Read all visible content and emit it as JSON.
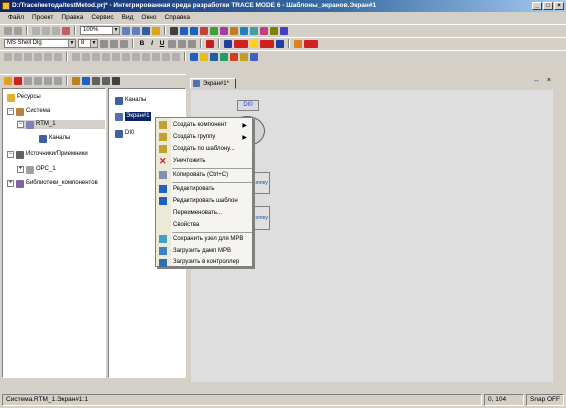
{
  "window": {
    "title": "D:/Trace/метода/testMetod.prj* - Интегрированная среда разработки TRACE MODE 6 - Шаблоны_экранов.Экран#1"
  },
  "menu": [
    "Файл",
    "Проект",
    "Правка",
    "Сервис",
    "Вид",
    "Окно",
    "Справка"
  ],
  "toolbar": {
    "zoom": "100%",
    "font": "MS Shell Dlg",
    "font_size": "8",
    "bold": "B",
    "italic": "I",
    "underline": "U"
  },
  "tree": {
    "items": [
      {
        "label": "Ресурсы"
      },
      {
        "label": "Система"
      },
      {
        "label": "RTM_1"
      },
      {
        "label": "Каналы"
      },
      {
        "label": "Источники/Приемники"
      },
      {
        "label": "OPC_1"
      },
      {
        "label": "Библиотеки_компонентов"
      }
    ]
  },
  "list": {
    "items": [
      {
        "label": "Каналы"
      },
      {
        "label": "Экран#1"
      },
      {
        "label": "DI0"
      }
    ]
  },
  "editor": {
    "tab": "Экран#1*",
    "label_di": "DI0",
    "btn1": "Кнопку",
    "btn2": "Кнопку"
  },
  "context_menu": {
    "items": [
      {
        "label": "Создать компонент",
        "submenu": true
      },
      {
        "label": "Создать группу",
        "submenu": true
      },
      {
        "label": "Создать по шаблону..."
      },
      {
        "label": "Уничтожить"
      },
      {
        "label": "Копировать (Ctrl+C)"
      },
      {
        "label": "Редактировать"
      },
      {
        "label": "Редактировать шаблон"
      },
      {
        "label": "Переименовать..."
      },
      {
        "label": "Свойства"
      },
      {
        "label": "Сохранить узел для МРВ"
      },
      {
        "label": "Загрузить дамп МРВ"
      },
      {
        "label": "Загрузить в контроллер"
      }
    ],
    "submenu_arrow": "▶"
  },
  "status": {
    "left": "Система.RTM_1.Экран#1:1",
    "coord": "0, 104",
    "snap": "Snap OFF"
  }
}
